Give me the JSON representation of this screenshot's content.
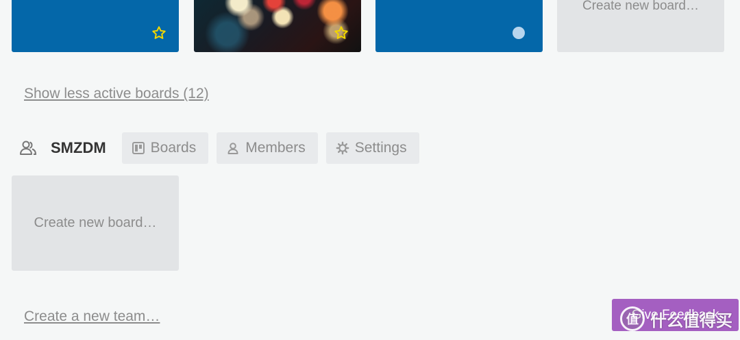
{
  "boards": {
    "tiles": [
      {
        "kind": "blue",
        "icon": "star-icon"
      },
      {
        "kind": "photo",
        "icon": "star-icon"
      },
      {
        "kind": "blue",
        "icon": "dot-icon"
      },
      {
        "kind": "create",
        "label": "Create new board…"
      }
    ],
    "show_less_label": "Show less active boards (12)"
  },
  "team": {
    "name": "SMZDM",
    "icon": "team-icon",
    "buttons": {
      "boards_label": "Boards",
      "members_label": "Members",
      "settings_label": "Settings"
    },
    "create_board_label": "Create new board…"
  },
  "create_team_label": "Create a new team…",
  "feedback_label": "Give Feedback",
  "watermark": {
    "text": "什么值得买",
    "badge": "值"
  },
  "colors": {
    "board_blue": "#0467a9",
    "star_yellow": "#f2d600",
    "feedback_purple": "#a45fc1",
    "page_bg": "#f5f7f7",
    "muted_text": "#8c8c8c"
  }
}
